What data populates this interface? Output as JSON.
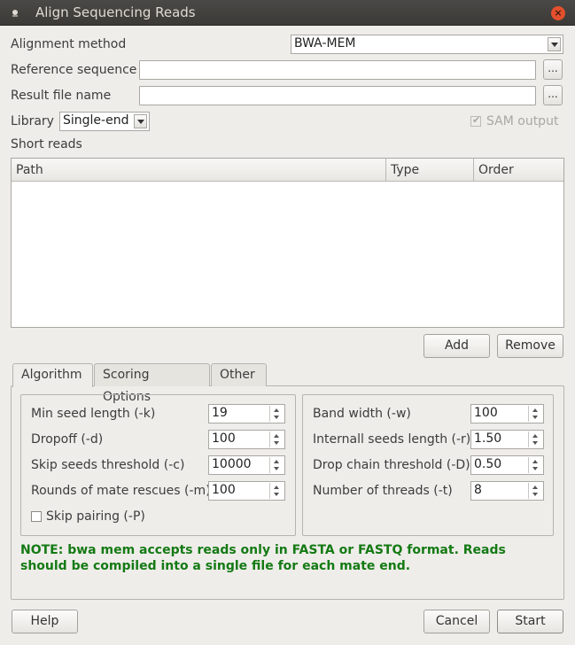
{
  "window": {
    "title": "Align Sequencing Reads",
    "close_glyph": "×"
  },
  "form": {
    "alignment_method_label": "Alignment method",
    "alignment_method_value": "BWA-MEM",
    "reference_label": "Reference sequence",
    "reference_value": "",
    "result_label": "Result file name",
    "result_value": "",
    "browse_label": "...",
    "library_label": "Library",
    "library_value": "Single-end",
    "sam_output_label": "SAM output",
    "sam_output_checked": true
  },
  "reads": {
    "section_label": "Short reads",
    "columns": [
      "Path",
      "Type",
      "Order"
    ],
    "rows": [],
    "add_label": "Add",
    "remove_label": "Remove"
  },
  "tabs": [
    {
      "label": "Algorithm",
      "active": true
    },
    {
      "label": "Scoring Options",
      "active": false
    },
    {
      "label": "Other",
      "active": false
    }
  ],
  "algorithm": {
    "left": [
      {
        "label": "Min seed length (-k)",
        "value": "19"
      },
      {
        "label": "Dropoff (-d)",
        "value": "100"
      },
      {
        "label": "Skip seeds threshold (-c)",
        "value": "10000"
      },
      {
        "label": "Rounds of mate rescues (-m)",
        "value": "100"
      }
    ],
    "skip_pairing_label": "Skip pairing (-P)",
    "skip_pairing_checked": false,
    "right": [
      {
        "label": "Band width (-w)",
        "value": "100"
      },
      {
        "label": "Internall seeds length (-r)",
        "value": "1.50"
      },
      {
        "label": "Drop chain threshold (-D)",
        "value": "0.50"
      },
      {
        "label": "Number of threads (-t)",
        "value": "8"
      }
    ]
  },
  "note": "NOTE: bwa mem accepts reads only in FASTA or FASTQ format. Reads should be compiled into a single file for each mate end.",
  "footer": {
    "help_label": "Help",
    "cancel_label": "Cancel",
    "start_label": "Start"
  },
  "colors": {
    "note": "#147a14",
    "titlebar": "#3b3a37",
    "close": "#e3502d"
  }
}
